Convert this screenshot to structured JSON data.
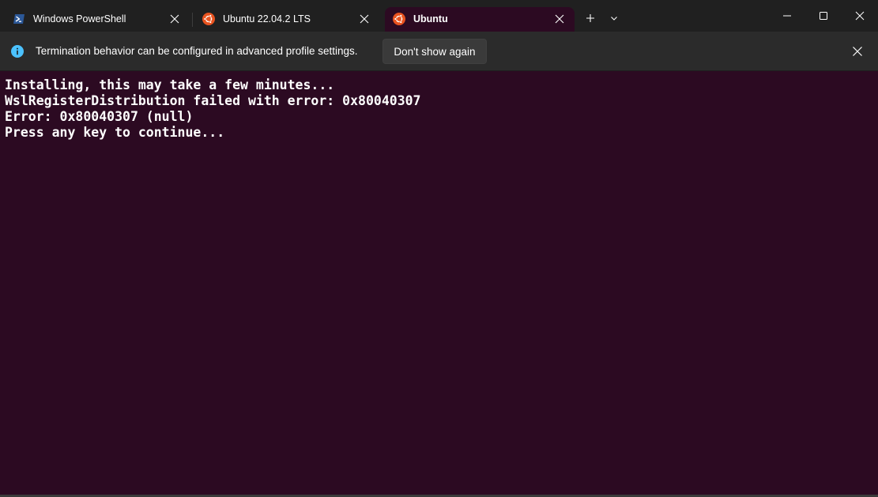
{
  "tabs": [
    {
      "label": "Windows PowerShell",
      "icon": "powershell-icon",
      "active": false
    },
    {
      "label": "Ubuntu 22.04.2 LTS",
      "icon": "ubuntu-icon",
      "active": false
    },
    {
      "label": "Ubuntu",
      "icon": "ubuntu-icon",
      "active": true
    }
  ],
  "infobar": {
    "message": "Termination behavior can be configured in advanced profile settings.",
    "button_label": "Don't show again",
    "icon": "info-icon"
  },
  "terminal": {
    "lines": [
      "Installing, this may take a few minutes...",
      "WslRegisterDistribution failed with error: 0x80040307",
      "Error: 0x80040307 (null)",
      "Press any key to continue..."
    ]
  },
  "colors": {
    "terminal_background": "#2c0a22",
    "titlebar_background": "#202020",
    "infobar_background": "#2b2b2b",
    "ubuntu_orange": "#e95420",
    "powershell_blue": "#2b5797",
    "info_blue": "#4cc2ff"
  }
}
